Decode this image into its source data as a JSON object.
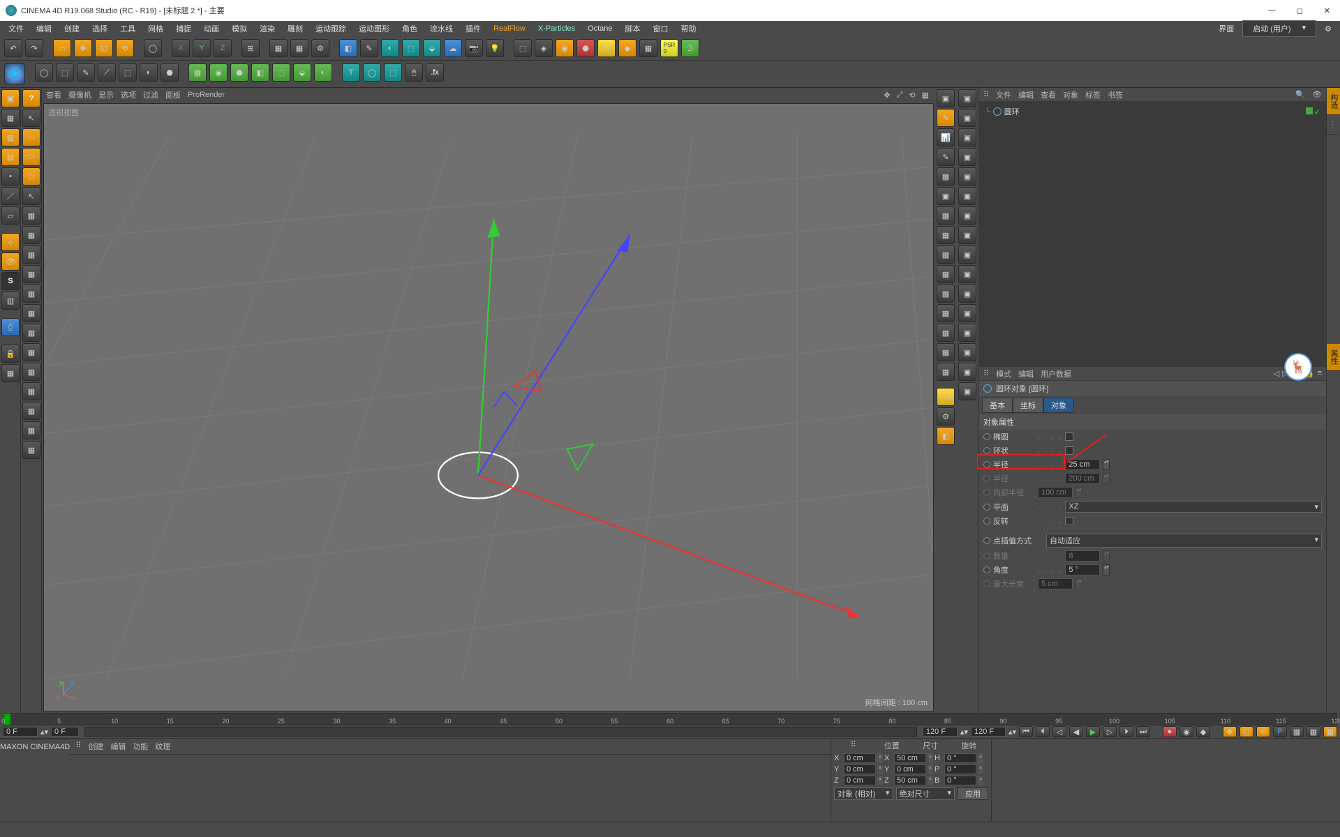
{
  "titlebar": {
    "app": "CINEMA 4D R19.068 Studio (RC - R19) - [未标题 2 *] - 主要"
  },
  "menubar": {
    "items": [
      "文件",
      "编辑",
      "创建",
      "选择",
      "工具",
      "网格",
      "捕捉",
      "动画",
      "模拟",
      "渲染",
      "雕刻",
      "运动跟踪",
      "运动图形",
      "角色",
      "流水线",
      "插件",
      "RealFlow",
      "X-Particles",
      "Octane",
      "脚本",
      "窗口",
      "帮助"
    ],
    "layout_label": "界面",
    "layout_value": "启动 (用户)"
  },
  "viewport": {
    "menu": [
      "查看",
      "摄像机",
      "显示",
      "选项",
      "过滤",
      "面板",
      "ProRender"
    ],
    "label": "透视视图",
    "footer": "网格间距 : 100 cm"
  },
  "obj_panel": {
    "menu": [
      "文件",
      "编辑",
      "查看",
      "对象",
      "标签",
      "书签"
    ],
    "item_name": "圆环"
  },
  "attr_panel": {
    "menu": [
      "模式",
      "编辑",
      "用户数据"
    ],
    "title": "圆环对象 [圆环]",
    "tabs": [
      "基本",
      "坐标",
      "对象"
    ],
    "section": "对象属性",
    "props": {
      "ellipse": "椭圆",
      "ring": "环状",
      "radius": "半径",
      "radius_val": "25 cm",
      "radius2": "半径",
      "radius2_val": "200 cm",
      "inner_radius": "内部半径",
      "inner_radius_val": "100 cm",
      "plane": "平面",
      "plane_val": "XZ",
      "reverse": "反转",
      "interp": "点插值方式",
      "interp_val": "自动适应",
      "count": "数量",
      "count_val": "8",
      "angle": "角度",
      "angle_val": "5 °",
      "maxlen": "最大长度",
      "maxlen_val": "5 cm"
    }
  },
  "timeline": {
    "start": "0 F",
    "current": "0 F",
    "end1": "120 F",
    "end2": "120 F",
    "ticks": [
      "0",
      "5",
      "10",
      "15",
      "20",
      "25",
      "30",
      "35",
      "40",
      "45",
      "50",
      "55",
      "60",
      "65",
      "70",
      "75",
      "80",
      "85",
      "90",
      "95",
      "100",
      "105",
      "110",
      "115",
      "120"
    ]
  },
  "bottom_tabs": [
    "创建",
    "编辑",
    "功能",
    "纹理"
  ],
  "coords": {
    "headers": [
      "位置",
      "尺寸",
      "旋转"
    ],
    "rows": [
      {
        "axis": "X",
        "pos": "0 cm",
        "size": "50 cm",
        "szax": "H",
        "rot": "0 °"
      },
      {
        "axis": "Y",
        "pos": "0 cm",
        "size": "0 cm",
        "szax": "P",
        "rot": "0 °"
      },
      {
        "axis": "Z",
        "pos": "0 cm",
        "size": "50 cm",
        "szax": "B",
        "rot": "0 °"
      }
    ],
    "mode1": "对象 (相对)",
    "mode2": "绝对尺寸",
    "apply": "应用"
  }
}
